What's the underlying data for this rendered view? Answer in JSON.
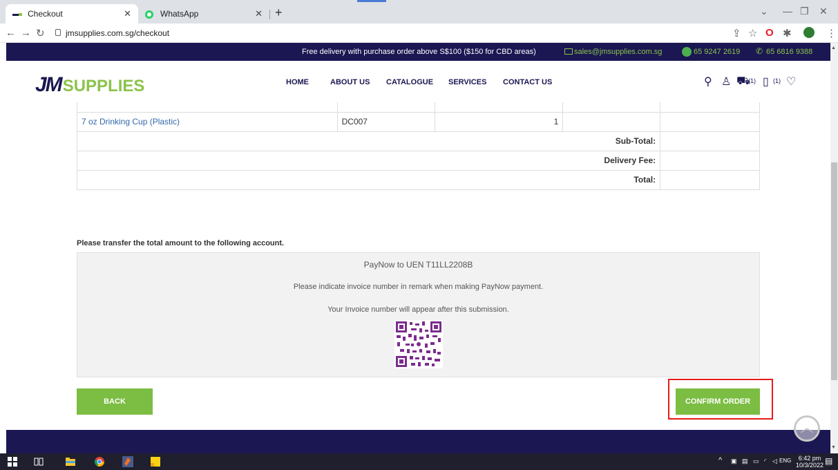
{
  "browser": {
    "tabs": [
      {
        "title": "Checkout",
        "active": true
      },
      {
        "title": "WhatsApp",
        "active": false
      }
    ],
    "url": "jmsupplies.com.sg/checkout"
  },
  "topbar": {
    "promo": "Free delivery with purchase order above S$100 ($150 for CBD areas)",
    "email": "sales@jmsupplies.com.sg",
    "whatsapp": "65 9247 2619",
    "phone": "65 6816 9388"
  },
  "header": {
    "logo_jm": "JM",
    "logo_supplies": "SUPPLIES",
    "menu": [
      "HOME",
      "ABOUT US",
      "CATALOGUE",
      "SERVICES",
      "CONTACT US"
    ],
    "cart_count": "(1)",
    "quote_count": "(1)"
  },
  "order_table": {
    "rows": [
      {
        "product": "7 oz Drinking Cup (Plastic)",
        "model": "DC007",
        "quantity": "1",
        "price": "",
        "total": ""
      }
    ],
    "summary": [
      {
        "label": "Sub-Total:",
        "value": ""
      },
      {
        "label": "Delivery Fee:",
        "value": ""
      },
      {
        "label": "Total:",
        "value": ""
      }
    ]
  },
  "payment": {
    "instruction": "Please transfer the total amount to the following account.",
    "paynow": "PayNow to UEN T11LL2208B",
    "remark": "Please indicate invoice number in remark when making PayNow payment.",
    "invoice_note": "Your Invoice number will appear after this submission."
  },
  "actions": {
    "back": "BACK",
    "confirm": "CONFIRM ORDER"
  },
  "taskbar": {
    "lang": "ENG",
    "time": "6:42 pm",
    "date": "10/3/2022"
  },
  "colors": {
    "navy": "#1b1752",
    "green": "#7cbd43",
    "highlight": "#e31b1b"
  }
}
